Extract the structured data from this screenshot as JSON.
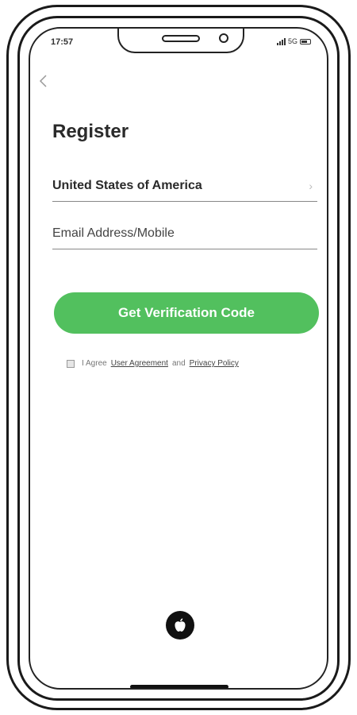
{
  "status_bar": {
    "time": "17:57",
    "network": "5G"
  },
  "header": {
    "back_icon": "chevron-left-icon",
    "title": "Register"
  },
  "form": {
    "country": "United States of America",
    "country_icon": "chevron-right-icon",
    "email_placeholder": "Email Address/Mobile",
    "email_value": ""
  },
  "actions": {
    "get_code_label": "Get Verification Code",
    "button_color": "#52c05e"
  },
  "agreement": {
    "checked": false,
    "prefix": "I Agree",
    "user_agreement": "User Agreement",
    "conjunction": "and",
    "privacy_policy": "Privacy Policy"
  },
  "social": {
    "apple_icon": "apple-logo-icon"
  }
}
